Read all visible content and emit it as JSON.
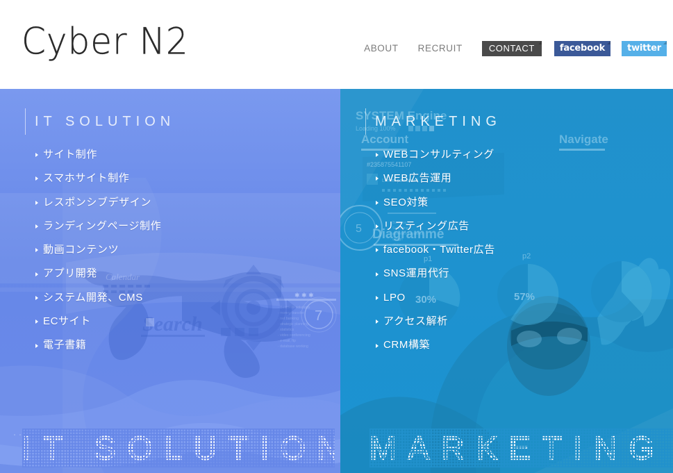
{
  "site": {
    "logo": "Cyber N2"
  },
  "header": {
    "nav": [
      {
        "label": "ABOUT",
        "name": "nav-about",
        "kind": "link"
      },
      {
        "label": "RECRUIT",
        "name": "nav-recruit",
        "kind": "link"
      },
      {
        "label": "CONTACT",
        "name": "nav-contact",
        "kind": "tag"
      },
      {
        "label": "facebook",
        "name": "nav-facebook",
        "kind": "social"
      },
      {
        "label": "twitter",
        "name": "nav-twitter",
        "kind": "social"
      }
    ],
    "colors": {
      "contact_bg": "#4a4a4a",
      "facebook_bg": "#3b5998",
      "twitter_bg": "#55b0e8",
      "nav_text": "#7b7b7b"
    }
  },
  "panels": {
    "left": {
      "heading": "IT SOLUTION",
      "wordmark": "IT SOLUTION",
      "bg_color": "#6687e8",
      "items": [
        "サイト制作",
        "スマホサイト制作",
        "レスポンシブデザイン",
        "ランディングページ制作",
        "動画コンテンツ",
        "アプリ開発",
        "システム開発、CMS",
        "ECサイト",
        "電子書籍"
      ],
      "background_graphics_text": [
        "Calendar",
        "Search"
      ]
    },
    "right": {
      "heading": "MARKETING",
      "wordmark": "MARKETING",
      "bg_color": "#2191cc",
      "items": [
        "WEBコンサルティング",
        "WEB広告運用",
        "SEO対策",
        "リスティング広告",
        "facebook・Twitter広告",
        "SNS運用代行",
        "LPO",
        "アクセス解析",
        "CRM構築"
      ],
      "background_graphics_text": [
        "SYSTEM Engine",
        "Loading 100%",
        "Account",
        "Navigate",
        "#235875541107",
        "Diagramme",
        "p1",
        "30%",
        "p2",
        "57%"
      ]
    }
  }
}
